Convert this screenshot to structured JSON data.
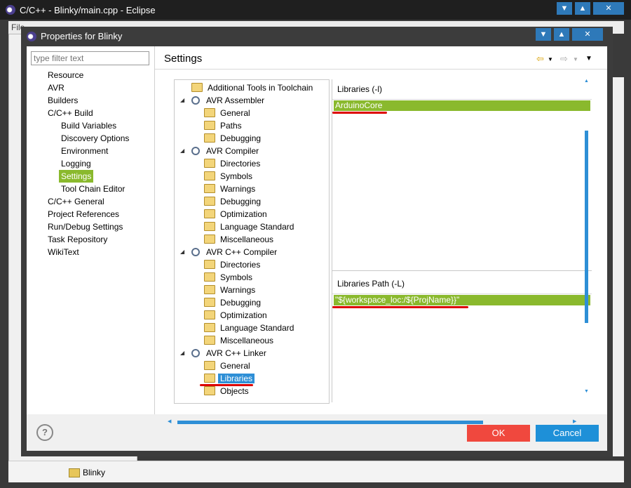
{
  "window": {
    "title": "C/C++ - Blinky/main.cpp - Eclipse",
    "menu_partial": "File"
  },
  "bottom_bar": {
    "project_label": "Blinky"
  },
  "dialog": {
    "title": "Properties for Blinky",
    "filter_placeholder": "type filter text",
    "nav_items": [
      {
        "label": "Resource"
      },
      {
        "label": "AVR"
      },
      {
        "label": "Builders"
      },
      {
        "label": "C/C++ Build"
      },
      {
        "label": "Build Variables"
      },
      {
        "label": "Discovery Options"
      },
      {
        "label": "Environment"
      },
      {
        "label": "Logging"
      },
      {
        "label": "Settings",
        "selected": true
      },
      {
        "label": "Tool Chain Editor"
      },
      {
        "label": "C/C++ General"
      },
      {
        "label": "Project References"
      },
      {
        "label": "Run/Debug Settings"
      },
      {
        "label": "Task Repository"
      },
      {
        "label": "WikiText"
      }
    ],
    "settings_title": "Settings",
    "tree": [
      {
        "label": "Additional Tools in Toolchain",
        "level": 0,
        "icon": "folder-icon"
      },
      {
        "label": "AVR Assembler",
        "level": 0,
        "icon": "gear-icon",
        "expanded": true
      },
      {
        "label": "General",
        "level": 1,
        "icon": "folder-icon"
      },
      {
        "label": "Paths",
        "level": 1,
        "icon": "folder-icon"
      },
      {
        "label": "Debugging",
        "level": 1,
        "icon": "folder-icon"
      },
      {
        "label": "AVR Compiler",
        "level": 0,
        "icon": "gear-icon",
        "expanded": true
      },
      {
        "label": "Directories",
        "level": 1,
        "icon": "folder-icon"
      },
      {
        "label": "Symbols",
        "level": 1,
        "icon": "folder-icon"
      },
      {
        "label": "Warnings",
        "level": 1,
        "icon": "folder-icon"
      },
      {
        "label": "Debugging",
        "level": 1,
        "icon": "folder-icon"
      },
      {
        "label": "Optimization",
        "level": 1,
        "icon": "folder-icon"
      },
      {
        "label": "Language Standard",
        "level": 1,
        "icon": "folder-icon"
      },
      {
        "label": "Miscellaneous",
        "level": 1,
        "icon": "folder-icon"
      },
      {
        "label": "AVR C++ Compiler",
        "level": 0,
        "icon": "gear-icon",
        "expanded": true
      },
      {
        "label": "Directories",
        "level": 1,
        "icon": "folder-icon"
      },
      {
        "label": "Symbols",
        "level": 1,
        "icon": "folder-icon"
      },
      {
        "label": "Warnings",
        "level": 1,
        "icon": "folder-icon"
      },
      {
        "label": "Debugging",
        "level": 1,
        "icon": "folder-icon"
      },
      {
        "label": "Optimization",
        "level": 1,
        "icon": "folder-icon"
      },
      {
        "label": "Language Standard",
        "level": 1,
        "icon": "folder-icon"
      },
      {
        "label": "Miscellaneous",
        "level": 1,
        "icon": "folder-icon"
      },
      {
        "label": "AVR C++ Linker",
        "level": 0,
        "icon": "gear-icon",
        "expanded": true
      },
      {
        "label": "General",
        "level": 1,
        "icon": "folder-icon"
      },
      {
        "label": "Libraries",
        "level": 1,
        "icon": "folder-icon",
        "selected": true
      },
      {
        "label": "Objects",
        "level": 1,
        "icon": "folder-icon"
      }
    ],
    "libraries": {
      "header": "Libraries (-l)",
      "items": [
        "ArduinoCore"
      ]
    },
    "library_paths": {
      "header": "Libraries Path (-L)",
      "items": [
        "\"${workspace_loc:/${ProjName}}\""
      ]
    },
    "ok_label": "OK",
    "cancel_label": "Cancel",
    "help_symbol": "?",
    "colors": {
      "selection_green": "#8ab92d",
      "selection_blue": "#2e8fd6",
      "ok_red": "#f0483e",
      "cancel_blue": "#1e90d8",
      "annotation_red": "#dd0000"
    }
  }
}
